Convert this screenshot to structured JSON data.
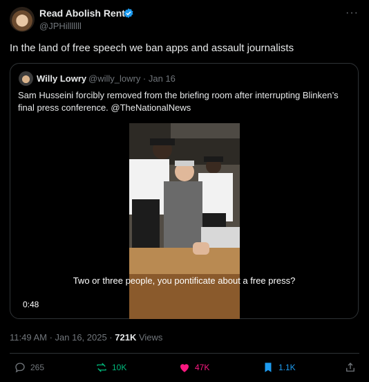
{
  "author": {
    "display_name": "Read Abolish Rent",
    "handle": "@JPHilllllll"
  },
  "tweet": {
    "text": "In the land of free speech we ban apps and assault journalists"
  },
  "quoted": {
    "name": "Willy Lowry",
    "handle": "@willy_lowry · Jan 16",
    "text": "Sam Husseini forcibly removed from the briefing room after interrupting Blinken’s final press conference. @TheNationalNews"
  },
  "video": {
    "caption": "Two or three people, you pontificate about a free press?",
    "duration": "0:48"
  },
  "meta": {
    "timestamp": "11:49 AM · Jan 16, 2025 · ",
    "views_count": "721K",
    "views_label": " Views"
  },
  "actions": {
    "replies": "265",
    "reposts": "10K",
    "likes": "47K",
    "bookmarks": "1.1K"
  },
  "colors": {
    "background": "#000000",
    "text": "#e7e9ea",
    "muted": "#71767b",
    "verified": "#1d9bf0",
    "repost": "#00ba7c",
    "like": "#f91880",
    "bookmark": "#1d9bf0"
  }
}
